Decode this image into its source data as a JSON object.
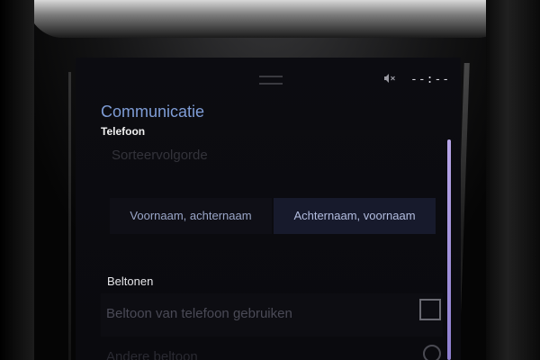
{
  "status": {
    "clock": "--:--",
    "mute_icon": "speaker-muted-icon",
    "handle_icon": "drag-handle-icon"
  },
  "header": {
    "title": "Communicatie",
    "subtitle": "Telefoon"
  },
  "sort_order": {
    "label": "Sorteervolgorde",
    "options": [
      "Voornaam, achternaam",
      "Achternaam, voornaam"
    ],
    "selected_index": 1
  },
  "ringtones": {
    "section_label": "Beltonen",
    "use_phone_ringtone_label": "Beltoon van telefoon gebruiken",
    "use_phone_ringtone_checked": false,
    "next_option_label": "Andere beltoon"
  },
  "colors": {
    "accent": "#7f9dd6",
    "scrollbar": "#b8a6e8"
  }
}
